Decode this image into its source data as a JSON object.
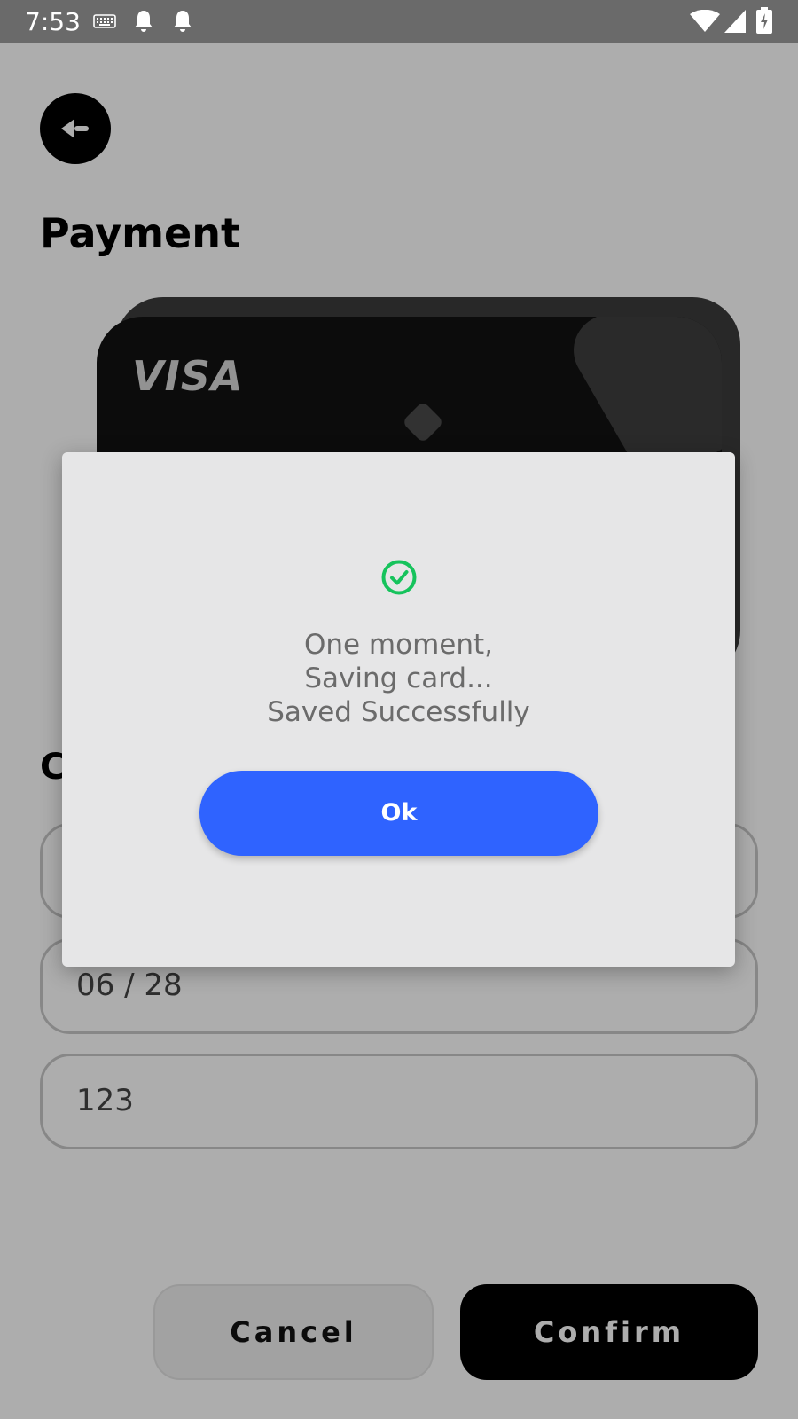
{
  "status_bar": {
    "time": "7:53",
    "left_icons": [
      "keyboard-icon",
      "notification-bell-icon",
      "notification-bell-icon"
    ],
    "right_icons": [
      "wifi-icon",
      "cellular-signal-icon",
      "battery-charging-icon"
    ]
  },
  "page": {
    "back_icon": "back-arrow-icon",
    "title": "Payment",
    "card": {
      "brand": "VISA"
    },
    "section_heading_visible": "C",
    "fields": {
      "card_number": "",
      "expiry": "06 / 28",
      "cvv": "123"
    },
    "cancel_label": "Cancel",
    "confirm_label": "Confirm"
  },
  "dialog": {
    "icon": "check-circle-icon",
    "line1": "One moment,",
    "line2": "Saving card...",
    "line3": "Saved Successfully",
    "ok_label": "Ok"
  },
  "colors": {
    "accent": "#2f63ff",
    "success": "#16c35c",
    "dialog_bg": "#e6e6e7",
    "scrim": "rgba(0,0,0,0.32)"
  }
}
